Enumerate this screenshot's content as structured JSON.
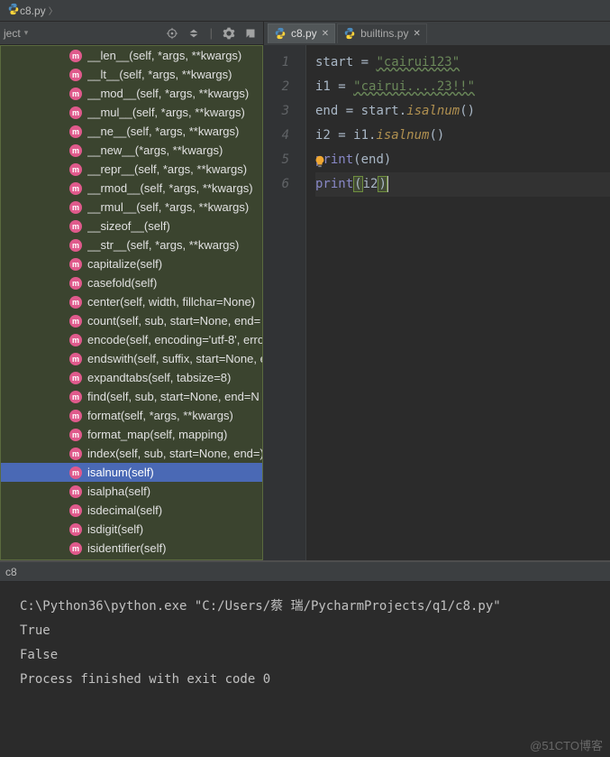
{
  "title_bar": {
    "filename": "c8.py"
  },
  "project_selector": {
    "label": "ject"
  },
  "tabs": [
    {
      "label": "c8.py",
      "active": true
    },
    {
      "label": "builtins.py",
      "active": false
    }
  ],
  "methods": [
    "__len__(self, *args, **kwargs)",
    "__lt__(self, *args, **kwargs)",
    "__mod__(self, *args, **kwargs)",
    "__mul__(self, *args, **kwargs)",
    "__ne__(self, *args, **kwargs)",
    "__new__(*args, **kwargs)",
    "__repr__(self, *args, **kwargs)",
    "__rmod__(self, *args, **kwargs)",
    "__rmul__(self, *args, **kwargs)",
    "__sizeof__(self)",
    "__str__(self, *args, **kwargs)",
    "capitalize(self)",
    "casefold(self)",
    "center(self, width, fillchar=None)",
    "count(self, sub, start=None, end=",
    "encode(self, encoding='utf-8', erro",
    "endswith(self, suffix, start=None, e",
    "expandtabs(self, tabsize=8)",
    "find(self, sub, start=None, end=N",
    "format(self, *args, **kwargs)",
    "format_map(self, mapping)",
    "index(self, sub, start=None, end=)",
    "isalnum(self)",
    "isalpha(self)",
    "isdecimal(self)",
    "isdigit(self)",
    "isidentifier(self)"
  ],
  "selected_method_index": 22,
  "line_numbers": [
    "1",
    "2",
    "3",
    "4",
    "5",
    "6"
  ],
  "code": {
    "l1": {
      "var": "start",
      "val": "\"cairui123\""
    },
    "l2": {
      "var": "i1",
      "val": "\"cairui....23!!\""
    },
    "l3": {
      "var": "end",
      "src": "start",
      "fn": "isalnum"
    },
    "l4": {
      "var": "i2",
      "src": "i1",
      "fn": "isalnum"
    },
    "l5": {
      "fn": "print",
      "arg": "end"
    },
    "l6": {
      "fn": "print",
      "arg": "i2"
    }
  },
  "terminal": {
    "tab": "c8",
    "line1": "C:\\Python36\\python.exe \"C:/Users/蔡 瑞/PycharmProjects/q1/c8.py\"",
    "line2": "True",
    "line3": "False",
    "line4": "",
    "line5": "Process finished with exit code 0"
  },
  "watermark": "@51CTO博客"
}
